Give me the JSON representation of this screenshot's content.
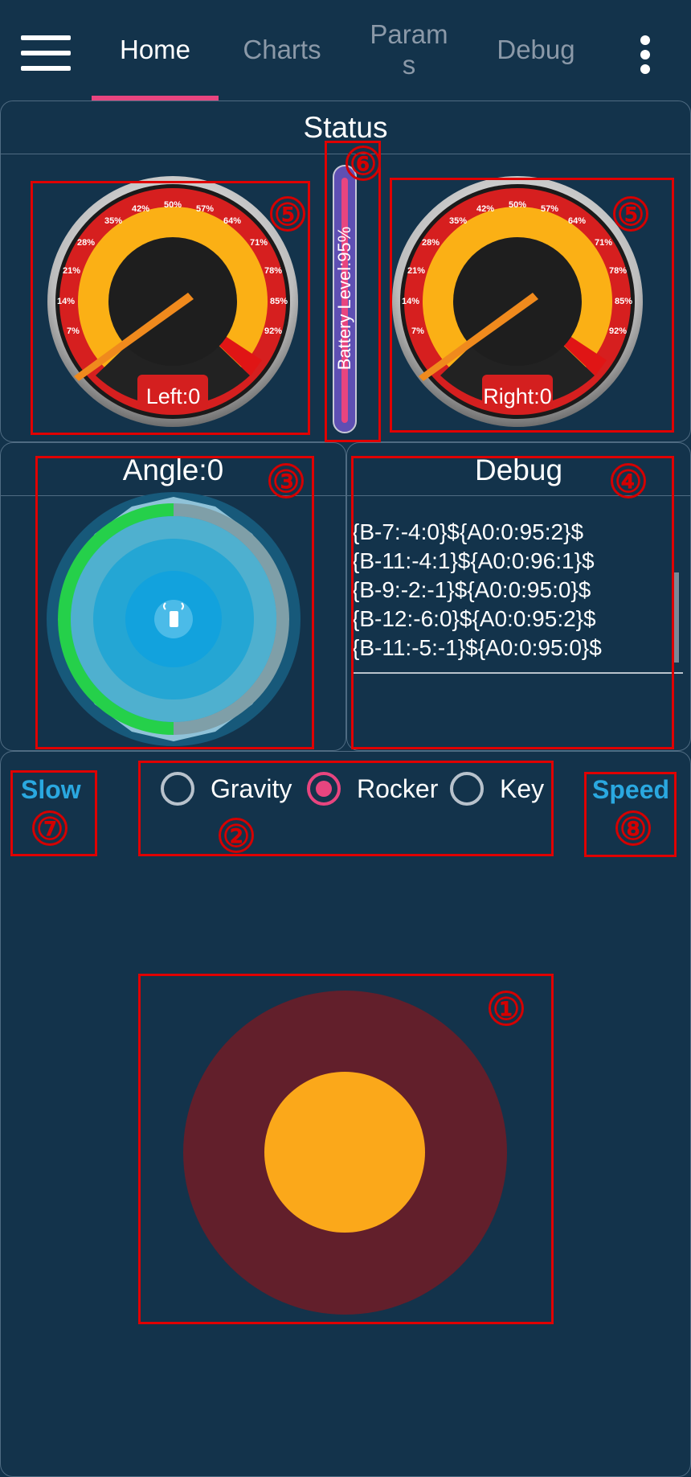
{
  "nav": {
    "tabs": [
      {
        "label": "Home",
        "active": true
      },
      {
        "label": "Charts",
        "active": false
      },
      {
        "label": "Param",
        "label2": "s",
        "active": false
      },
      {
        "label": "Debug",
        "active": false
      }
    ],
    "menu_icon": "hamburger-menu-icon",
    "overflow_icon": "more-vertical-icon"
  },
  "status": {
    "title": "Status",
    "left_gauge": {
      "label": "Left:0",
      "value": 0
    },
    "right_gauge": {
      "label": "Right:0",
      "value": 0
    },
    "gauge_ticks": [
      "7%",
      "14%",
      "21%",
      "28%",
      "35%",
      "42%",
      "50%",
      "57%",
      "64%",
      "71%",
      "78%",
      "85%",
      "92%"
    ],
    "battery": {
      "label": "Battery Level:95%",
      "level": 95
    }
  },
  "angle": {
    "title": "Angle:0",
    "icon": "phone-signal-icon"
  },
  "debug": {
    "title": "Debug",
    "lines": [
      "{B-7:-4:0}${A0:0:95:2}$",
      "{B-11:-4:1}${A0:0:96:1}$",
      "{B-9:-2:-1}${A0:0:95:0}$",
      "{B-12:-6:0}${A0:0:95:2}$",
      "{B-11:-5:-1}${A0:0:95:0}$"
    ]
  },
  "controls": {
    "slow_label": "Slow",
    "speed_label": "Speed",
    "modes": [
      {
        "label": "Gravity",
        "selected": false
      },
      {
        "label": "Rocker",
        "selected": true
      },
      {
        "label": "Key",
        "selected": false
      }
    ]
  },
  "markers": [
    "①",
    "②",
    "③",
    "④",
    "⑤",
    "⑤",
    "⑥",
    "⑦",
    "⑧"
  ],
  "colors": {
    "background": "#13334b",
    "accent": "#e8457f",
    "annotation": "#e00000",
    "joystick_outer": "#621f2b",
    "joystick_knob": "#fba81a",
    "speed_text": "#2aa8e0"
  }
}
